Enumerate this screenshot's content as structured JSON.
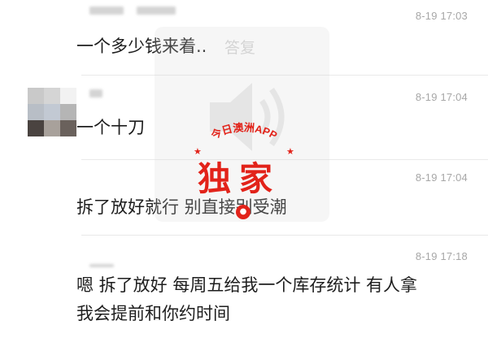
{
  "messages": [
    {
      "time": "8-19 17:03",
      "text": "一个多少钱来着.."
    },
    {
      "time": "8-19 17:04",
      "text": "一个十刀"
    },
    {
      "time": "8-19 17:04",
      "text": "拆了放好就行 别直接别受潮"
    },
    {
      "time": "8-19 17:18",
      "text_lines": [
        "嗯 拆了放好 每周五给我一个库存统计  有人拿",
        "我会提前和你约时间"
      ]
    }
  ],
  "watermark": {
    "arc_text": "今日澳洲APP",
    "big_text": "独家",
    "faint_label": "答复",
    "dot_glyph": "●",
    "brand_color": "#e2231a",
    "icon": "speaker-icon"
  }
}
